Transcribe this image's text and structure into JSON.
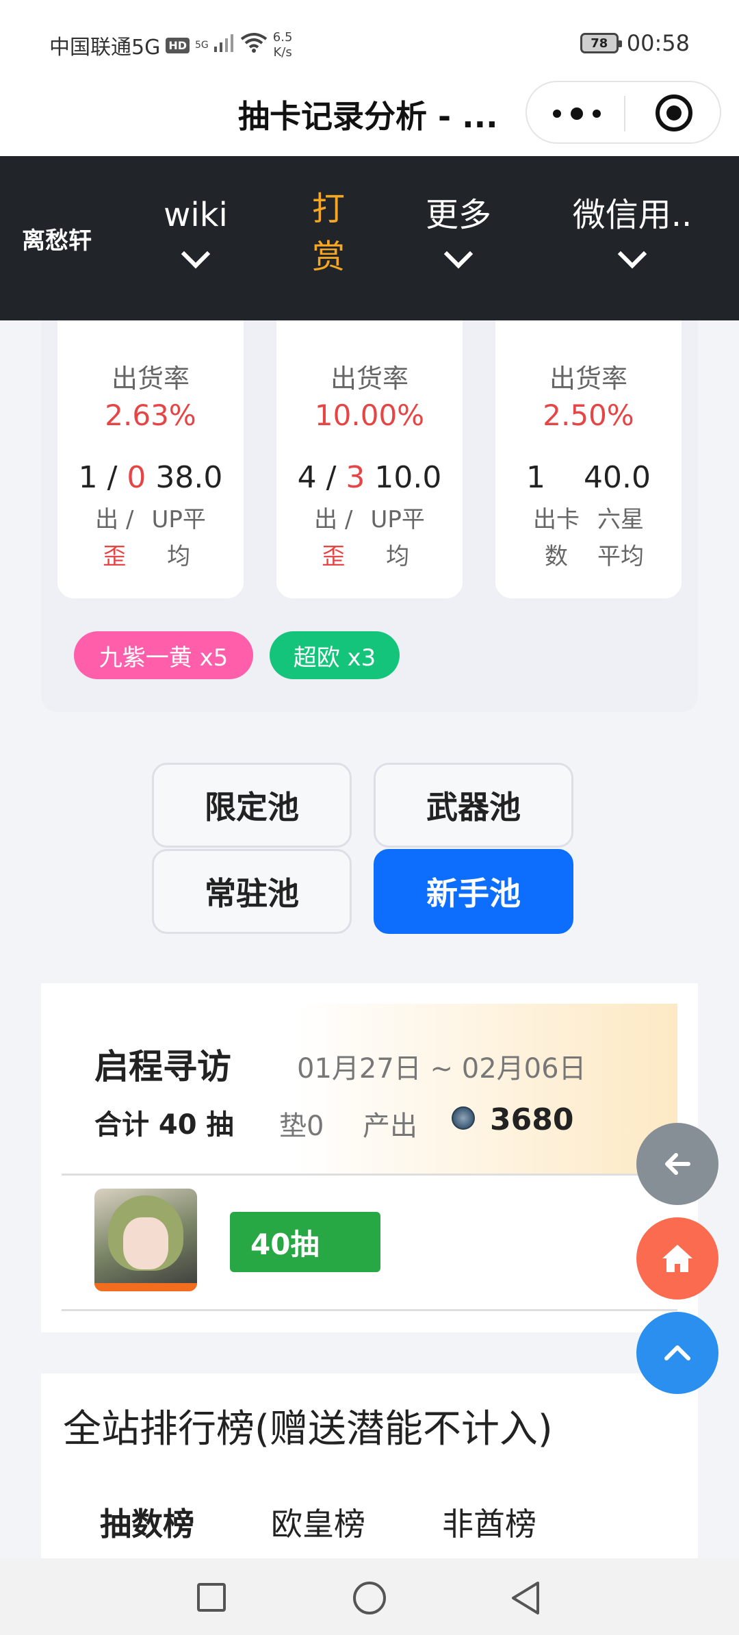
{
  "status_bar": {
    "carrier": "中国联通5G",
    "hd": "HD",
    "signal_tag": "5G",
    "net_speed_value": "6.5",
    "net_speed_unit": "K/s",
    "battery": "78",
    "time": "00:58"
  },
  "titlebar": {
    "title": "抽卡记录分析 - ..."
  },
  "nav": {
    "brand": "离愁轩",
    "items": [
      "wiki",
      "打赏",
      "更多",
      "微信用.."
    ]
  },
  "stats": [
    {
      "rate_label": "出货率",
      "rate": "2.63%",
      "num_a": "1",
      "slash": " / ",
      "num_b": "0",
      "num_c": "38.0",
      "label_a1": "出 /",
      "label_a2": "歪",
      "label_b1": "UP平",
      "label_b2": "均"
    },
    {
      "rate_label": "出货率",
      "rate": "10.00%",
      "num_a": "4",
      "slash": " / ",
      "num_b": "3",
      "num_c": "10.0",
      "label_a1": "出 /",
      "label_a2": "歪",
      "label_b1": "UP平",
      "label_b2": "均"
    },
    {
      "rate_label": "出货率",
      "rate": "2.50%",
      "num_a": "1",
      "slash": "",
      "num_b": "",
      "num_c": "40.0",
      "label_a1": "出卡",
      "label_a2": "数",
      "label_b1": "六星",
      "label_b2": "平均"
    }
  ],
  "tags": [
    "九紫一黄 x5",
    "超欧 x3"
  ],
  "pools": [
    "限定池",
    "武器池",
    "常驻池",
    "新手池"
  ],
  "event": {
    "title": "启程寻访",
    "date": "01月27日 ~ 02月06日",
    "total": "合计 40 抽",
    "pad": "垫0",
    "output_label": "产出",
    "output_value": "3680",
    "pull_label": "40抽"
  },
  "leaderboard": {
    "title": "全站排行榜(赠送潜能不计入)",
    "tabs": [
      "抽数榜",
      "欧皇榜",
      "非酋榜"
    ]
  },
  "colors": {
    "accent": "#0d6efd",
    "red": "#e64545",
    "nav_bg": "#212529",
    "reward": "#f5a623"
  }
}
